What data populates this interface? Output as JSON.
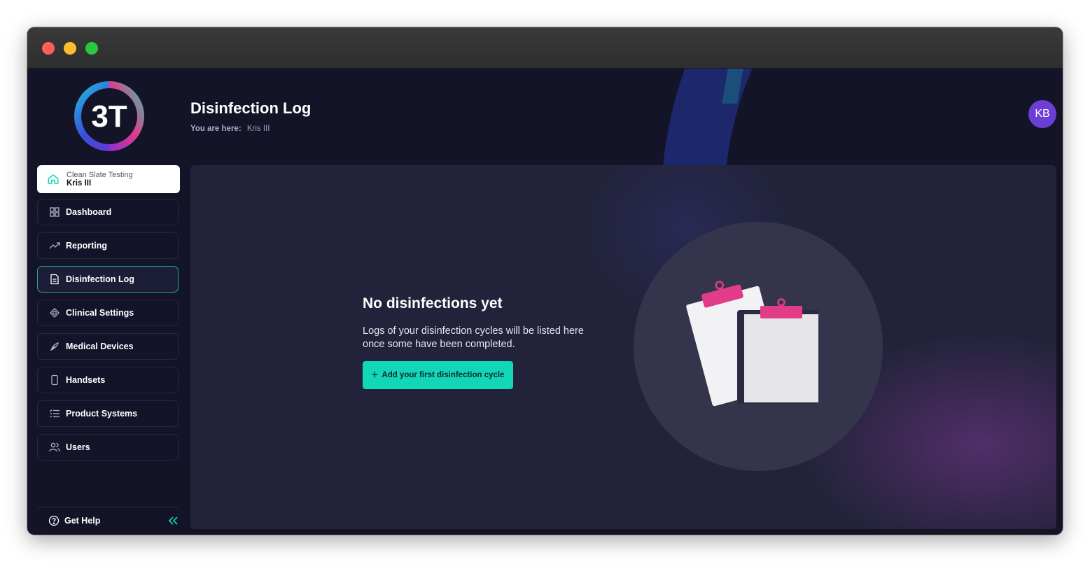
{
  "colors": {
    "accent": "#12d6b8",
    "background": "#141428",
    "panel": "#22233a",
    "avatar": "#6b3fd6",
    "clip": "#e23b8a"
  },
  "logo": {
    "text": "3T"
  },
  "site": {
    "org": "Clean Slate Testing",
    "name": "Kris III",
    "icon": "home-icon"
  },
  "nav": [
    {
      "label": "Dashboard",
      "icon": "grid-icon"
    },
    {
      "label": "Reporting",
      "icon": "trend-icon"
    },
    {
      "label": "Disinfection Log",
      "icon": "document-icon",
      "active": true
    },
    {
      "label": "Clinical Settings",
      "icon": "target-icon"
    },
    {
      "label": "Medical Devices",
      "icon": "feather-icon"
    },
    {
      "label": "Handsets",
      "icon": "phone-icon"
    },
    {
      "label": "Product Systems",
      "icon": "list-icon"
    },
    {
      "label": "Users",
      "icon": "users-icon"
    }
  ],
  "help": {
    "label": "Get Help"
  },
  "header": {
    "title": "Disinfection Log",
    "breadcrumb_label": "You are here:",
    "breadcrumb_value": "Kris III"
  },
  "user": {
    "initials": "KB"
  },
  "empty": {
    "title": "No disinfections yet",
    "description": "Logs of your disinfection cycles will be listed here once some have been completed.",
    "button": "Add your first disinfection cycle"
  }
}
